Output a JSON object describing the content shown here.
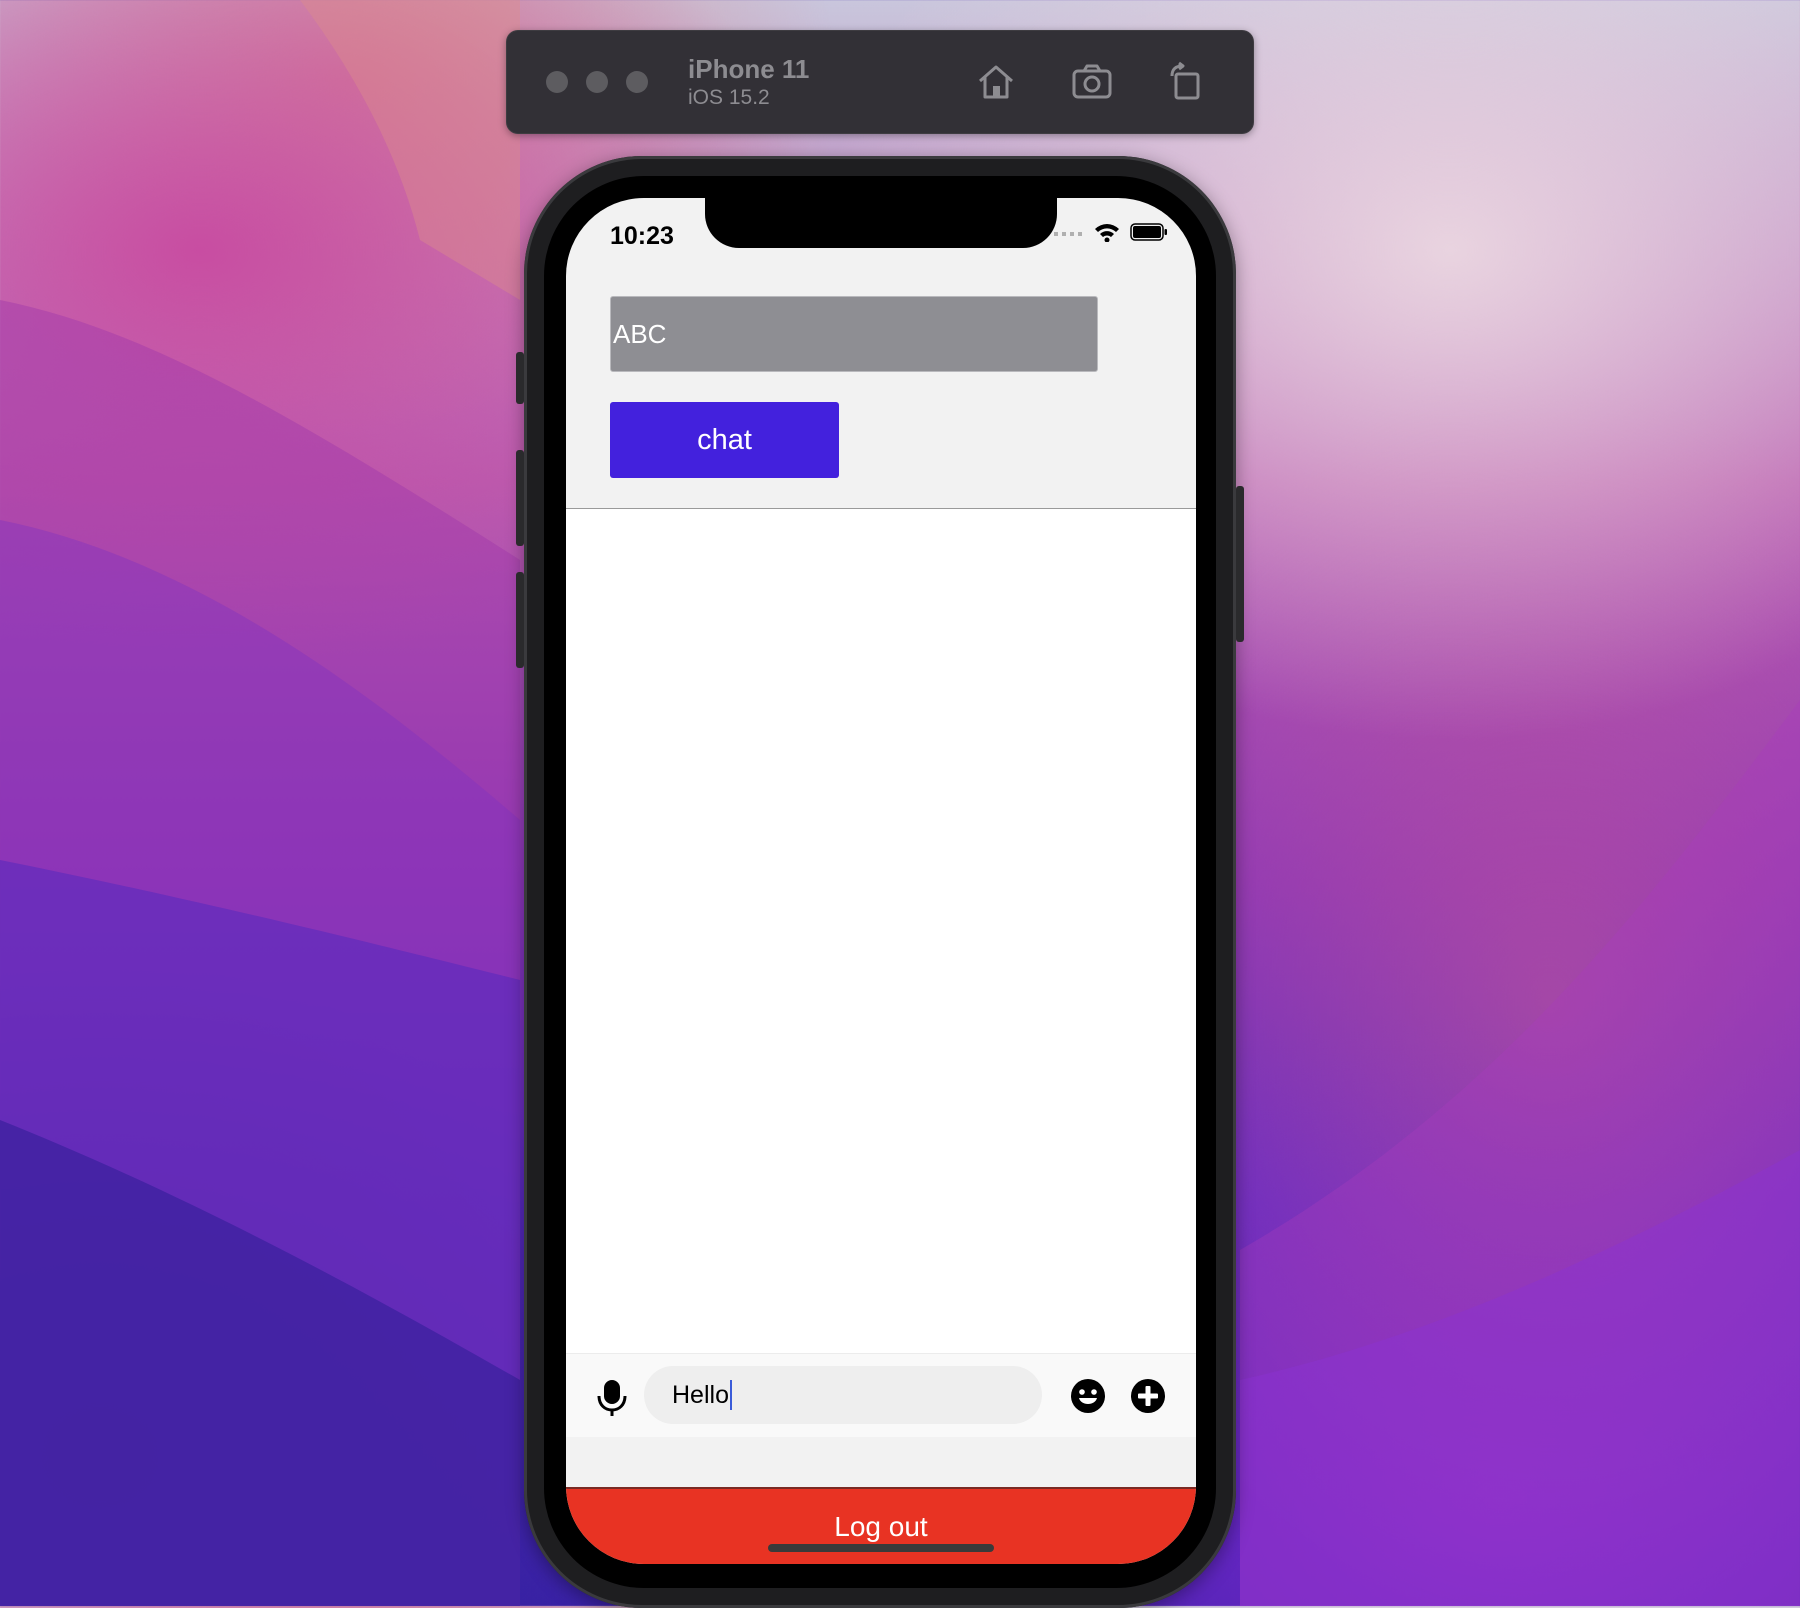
{
  "simulator": {
    "device_name": "iPhone 11",
    "os_version": "iOS 15.2",
    "toolbar_icons": [
      "home-icon",
      "screenshot-camera-icon",
      "rotate-icon"
    ]
  },
  "status_bar": {
    "time": "10:23",
    "icons": [
      "signal-dots-icon",
      "wifi-icon",
      "battery-icon"
    ]
  },
  "app": {
    "name_field_value": "ABC",
    "chat_button_label": "chat",
    "message_input_value": "Hello",
    "input_icons": [
      "microphone-icon",
      "emoji-icon",
      "plus-circle-icon"
    ],
    "logout_label": "Log out"
  },
  "colors": {
    "chat_button": "#4321dd",
    "logout_bar": "#e83323",
    "name_field": "#8e8e93"
  }
}
